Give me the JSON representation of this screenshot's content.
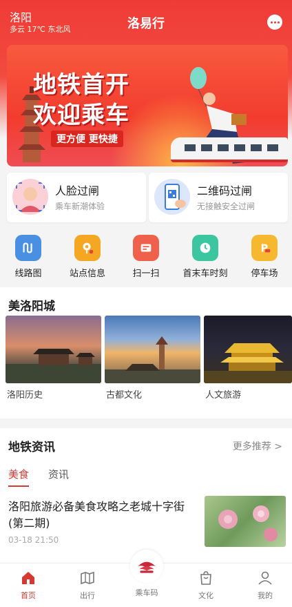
{
  "header": {
    "city": "洛阳",
    "weather": "多云 17℃ 东北风",
    "title": "洛易行"
  },
  "banner": {
    "line1": "地铁首开",
    "line2": "欢迎乘车",
    "tagline": "更方便 更快捷"
  },
  "pass_cards": [
    {
      "title": "人脸过闸",
      "subtitle": "乘车新潮体验",
      "icon": "face-icon"
    },
    {
      "title": "二维码过闸",
      "subtitle": "无接触安全过闸",
      "icon": "qr-phone-icon"
    }
  ],
  "quick_actions": [
    {
      "label": "线路图",
      "icon": "route-map-icon",
      "color": "#4a90e2"
    },
    {
      "label": "站点信息",
      "icon": "station-info-icon",
      "color": "#f5a623"
    },
    {
      "label": "扫一扫",
      "icon": "scan-icon",
      "color": "#f0614b"
    },
    {
      "label": "首末车时刻",
      "icon": "clock-icon",
      "color": "#3cc6a0"
    },
    {
      "label": "停车场",
      "icon": "parking-icon",
      "color": "#f5b82e"
    }
  ],
  "city_section": {
    "title": "美洛阳城",
    "items": [
      {
        "label": "洛阳历史"
      },
      {
        "label": "古都文化"
      },
      {
        "label": "人文旅游"
      }
    ]
  },
  "news": {
    "title": "地铁资讯",
    "more": "更多推荐 >",
    "tabs": [
      {
        "label": "美食"
      },
      {
        "label": "资讯"
      }
    ],
    "article": {
      "title": "洛阳旅游必备美食攻略之老城十字街(第二期)",
      "date": "03-18 21:50"
    }
  },
  "bottom_nav": [
    {
      "label": "首页",
      "icon": "home-icon",
      "active": true
    },
    {
      "label": "出行",
      "icon": "map-icon",
      "active": false
    },
    {
      "label": "乘车码",
      "icon": "ride-code-icon",
      "active": false
    },
    {
      "label": "文化",
      "icon": "bag-icon",
      "active": false
    },
    {
      "label": "我的",
      "icon": "user-icon",
      "active": false
    }
  ],
  "colors": {
    "brand": "#ef3b36",
    "accent": "#d43a33"
  }
}
